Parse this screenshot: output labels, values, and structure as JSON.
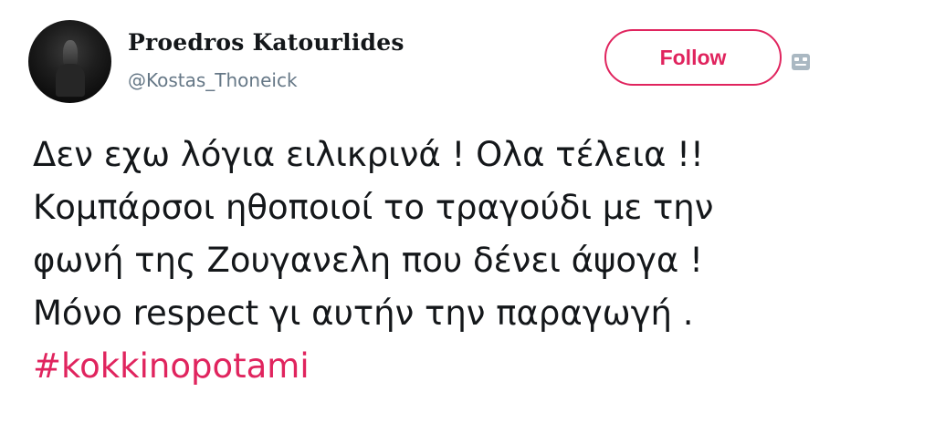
{
  "author": {
    "display_name": "Proedros Katourlides",
    "handle": "@Kostas_Thoneick",
    "avatar_icon": "profile-photo"
  },
  "follow_button": {
    "label": "Follow",
    "accent_color": "#e0245e"
  },
  "brand_icon": "tweet-brand-icon",
  "tweet": {
    "lines": [
      "Δεν εχω λόγια ειλικρινά ! Ολα τέλεια !!",
      "Κομπάρσοι ηθοποιοί το τραγούδι με την",
      "φωνή της Ζουγανελη που δένει άψογα !",
      "Μόνο respect γι αυτήν την παραγωγή ."
    ],
    "hashtag": "#kokkinopotami",
    "hashtag_color": "#e0245e"
  }
}
